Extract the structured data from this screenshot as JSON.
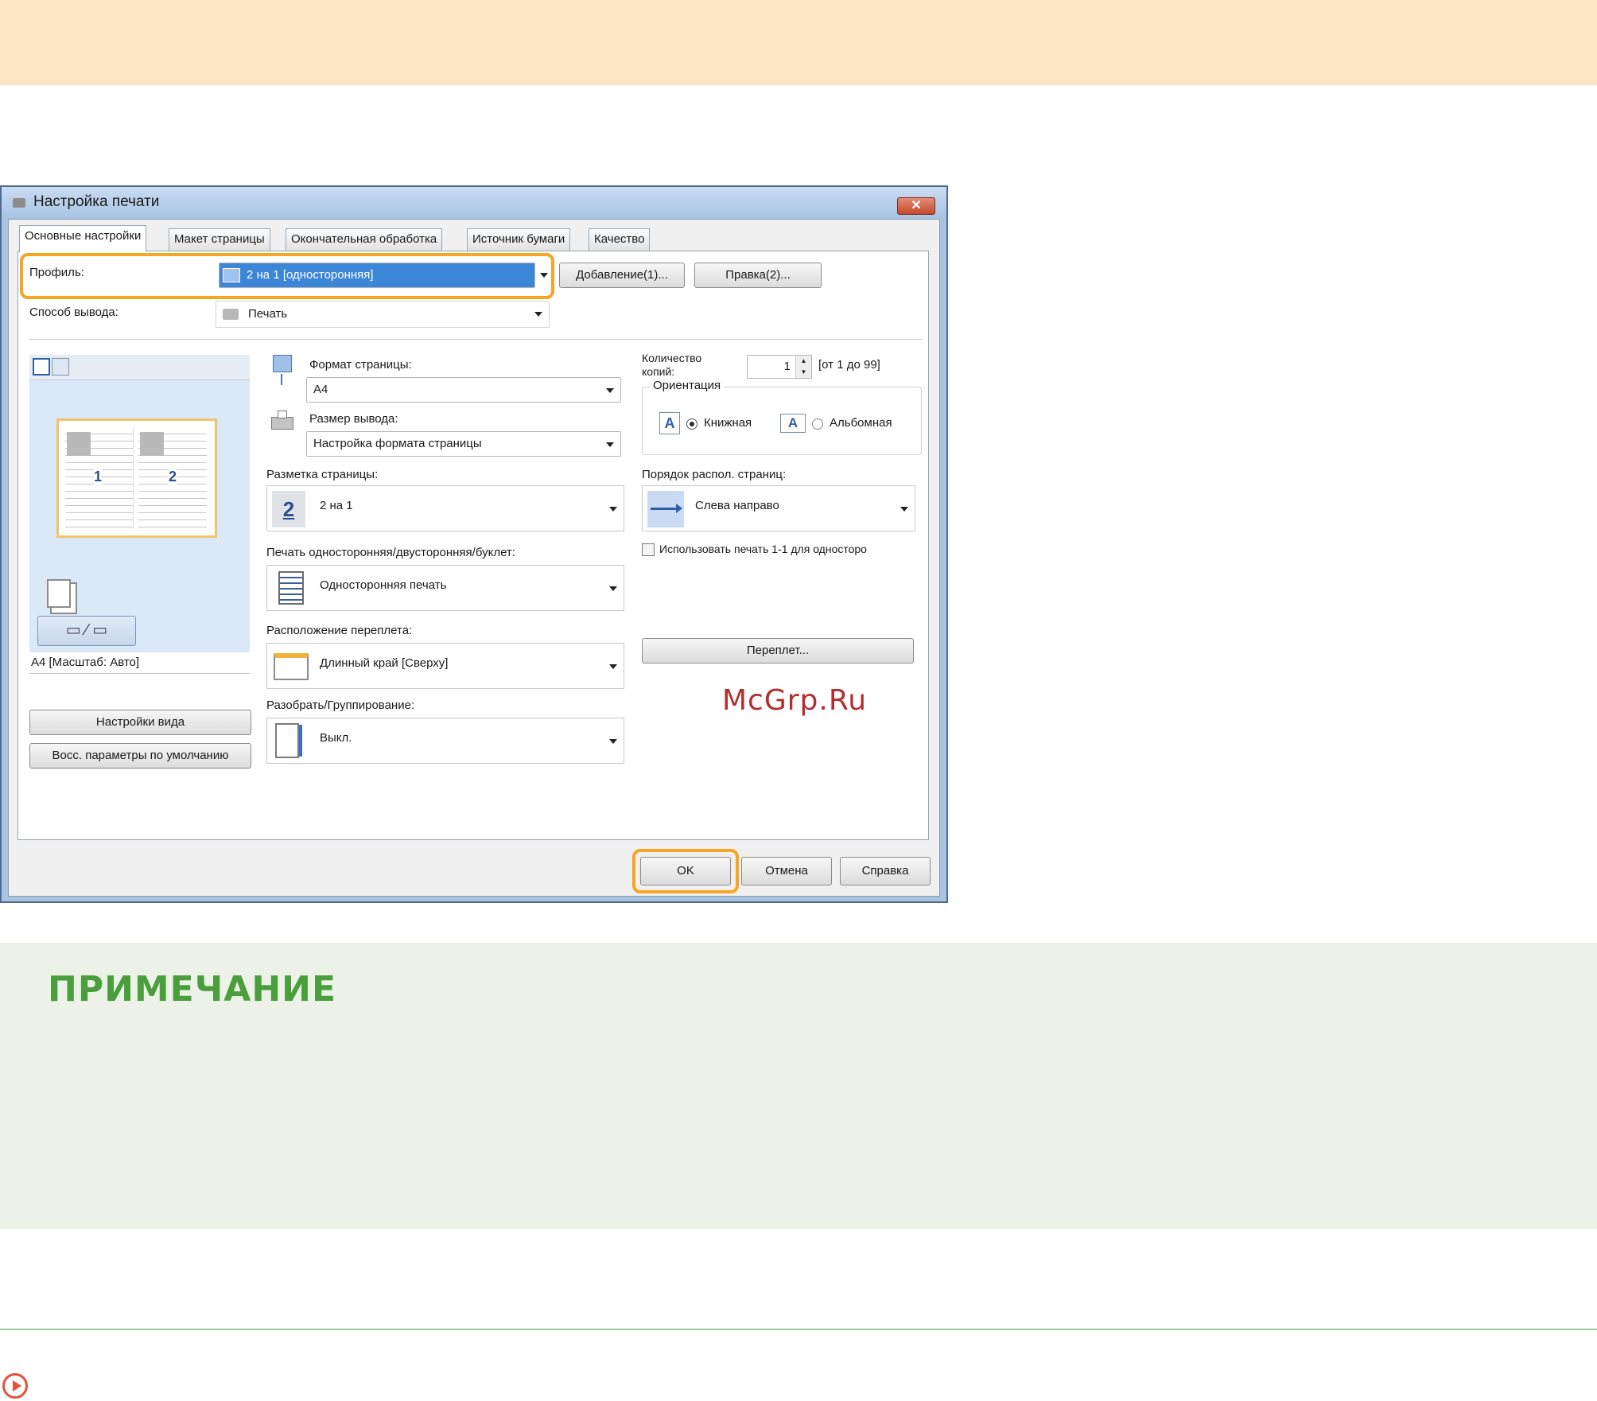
{
  "watermark": "McGrp.Ru",
  "note": {
    "title": "ПРИМЕЧАНИЕ"
  },
  "dialog": {
    "title": "Настройка печати",
    "close_label": "✕",
    "tabs": [
      {
        "label": "Основные настройки"
      },
      {
        "label": "Макет страницы"
      },
      {
        "label": "Окончательная обработка"
      },
      {
        "label": "Источник бумаги"
      },
      {
        "label": "Качество"
      }
    ],
    "profile": {
      "label": "Профиль:",
      "value": "2 на 1 [односторонняя]",
      "add_button": "Добавление(1)...",
      "edit_button": "Правка(2)..."
    },
    "output": {
      "label": "Способ вывода:",
      "value": "Печать"
    },
    "preview": {
      "page_numbers": [
        "1",
        "2"
      ],
      "caption": "A4 [Масштаб: Авто]",
      "view_settings_button": "Настройки вида",
      "restore_defaults_button": "Восс. параметры по умолчанию"
    },
    "page_size": {
      "label": "Формат страницы:",
      "value": "A4"
    },
    "output_size": {
      "label": "Размер вывода:",
      "value": "Настройка формата страницы"
    },
    "page_layout": {
      "label": "Разметка страницы:",
      "value": "2 на 1",
      "icon_digit": "2"
    },
    "print_style": {
      "label": "Печать односторонняя/двусторонняя/буклет:",
      "value": "Односторонняя печать"
    },
    "binding_location": {
      "label": "Расположение переплета:",
      "value": "Длинный край [Сверху]"
    },
    "collate": {
      "label": "Разобрать/Группирование:",
      "value": "Выкл."
    },
    "copies": {
      "label": "Количество копий:",
      "value": "1",
      "range": "[от 1 до 99]"
    },
    "orientation": {
      "label": "Ориентация",
      "portrait": "Книжная",
      "landscape": "Альбомная",
      "selected": "portrait"
    },
    "page_order": {
      "label": "Порядок распол. страниц:",
      "value": "Слева направо"
    },
    "use_1_1_checkbox": "Использовать печать 1-1 для односторо",
    "binding_button": "Переплет...",
    "ok_button": "OK",
    "cancel_button": "Отмена",
    "help_button": "Справка"
  }
}
